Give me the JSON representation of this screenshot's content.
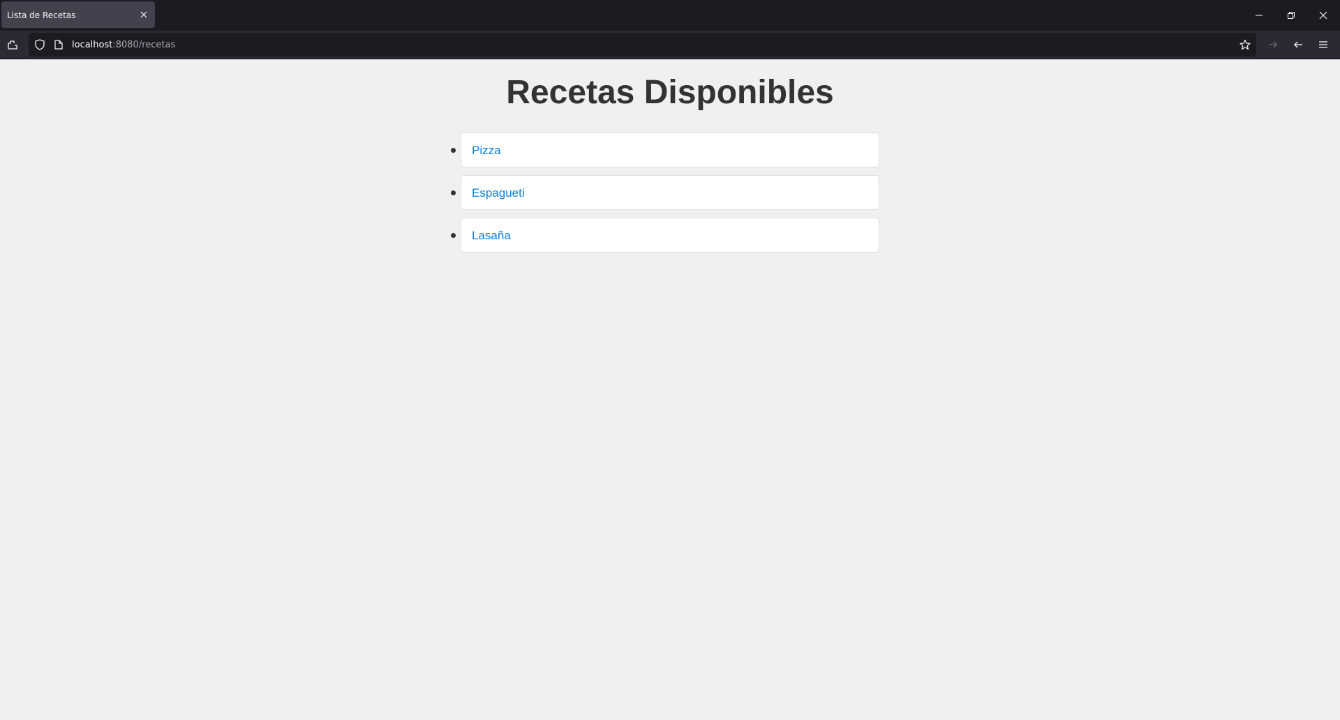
{
  "browser": {
    "tab_title": "Lista de Recetas",
    "url_host": "localhost",
    "url_path": ":8080/recetas"
  },
  "page": {
    "title": "Recetas Disponibles",
    "recipes": [
      {
        "label": "Pizza"
      },
      {
        "label": "Espagueti"
      },
      {
        "label": "Lasaña"
      }
    ]
  },
  "colors": {
    "background": "#f0f0f0",
    "title": "#333333",
    "link": "#0b7dda",
    "card": "#ffffff",
    "chrome": "#1c1b22"
  }
}
